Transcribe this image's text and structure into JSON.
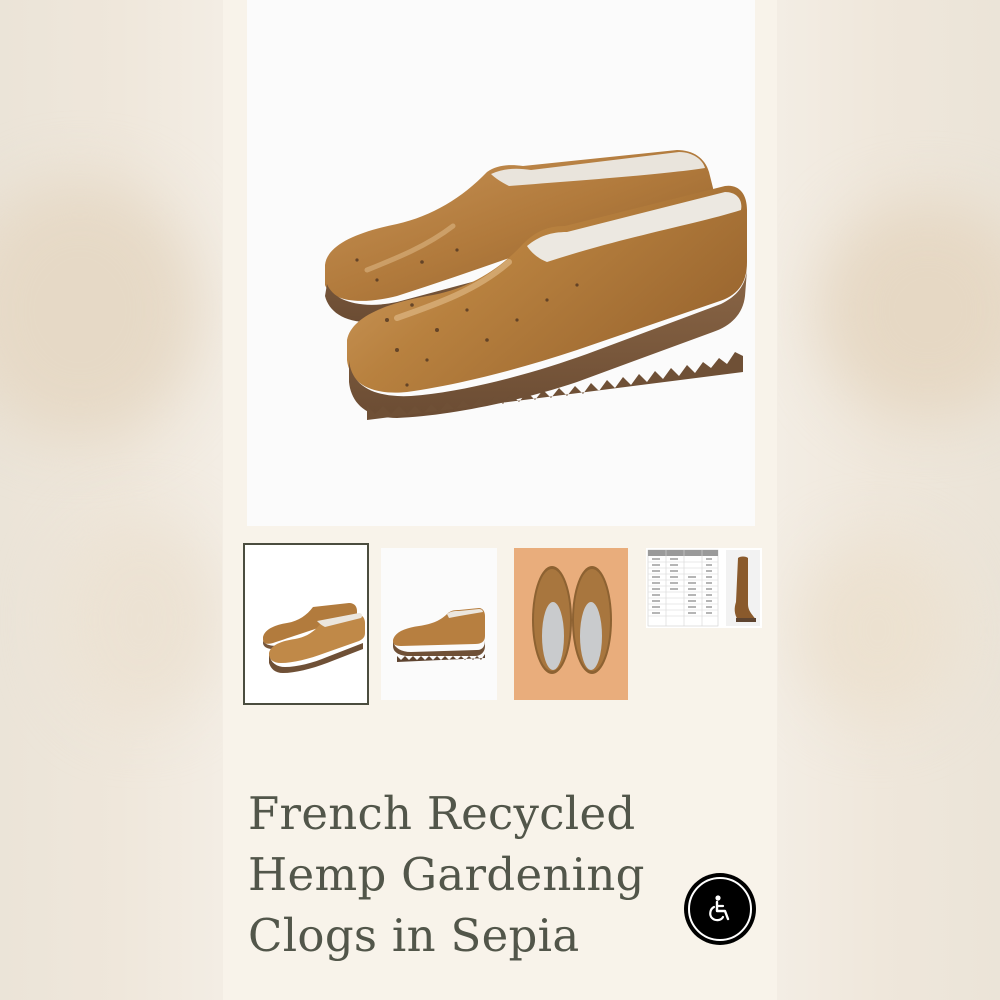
{
  "product": {
    "title": "French Recycled Hemp Gardening Clogs in Sepia",
    "main_image_icon": "clogs-pair-angle-image",
    "color_name_accent": "#b07a3a"
  },
  "thumbnails": [
    {
      "icon": "clogs-pair-angle-thumbnail",
      "selected": true
    },
    {
      "icon": "clog-side-view-thumbnail",
      "selected": false
    },
    {
      "icon": "clogs-top-view-thumbnail",
      "selected": false
    },
    {
      "icon": "size-chart-thumbnail",
      "selected": false
    }
  ],
  "accessibility": {
    "icon": "wheelchair-accessibility-icon"
  },
  "colors": {
    "page_background": "#f8f3ea",
    "title_text": "#52564a",
    "thumbnail_border": "#4b4d3f",
    "clog_tan": "#b07a3a",
    "sole_brown": "#7a5a40",
    "top_view_background": "#e9ad7c"
  }
}
